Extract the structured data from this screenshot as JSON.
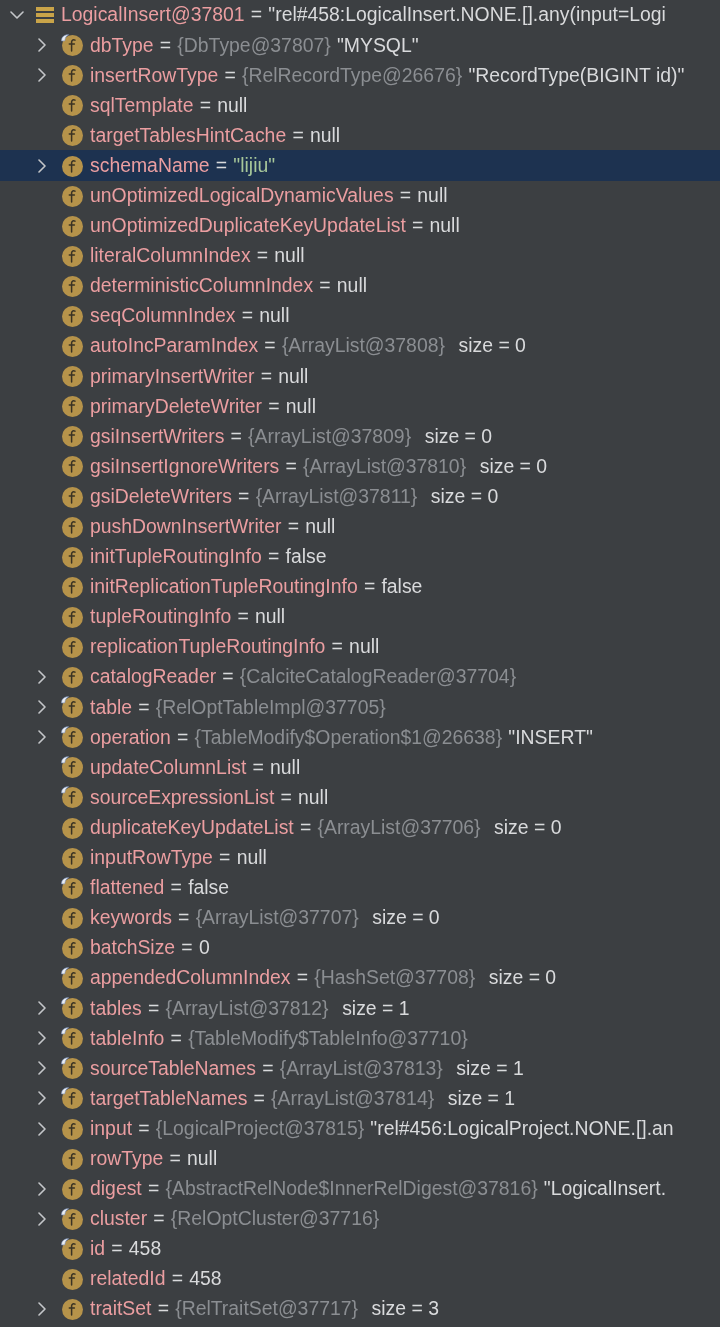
{
  "tree": {
    "root": {
      "name": "LogicalInsert@37801",
      "sign": "=",
      "value": "\"rel#458:LogicalInsert.NONE.[].any(input=Logi",
      "expanded": true,
      "selected": false
    },
    "fields": [
      {
        "name": "dbType",
        "sign": "=",
        "type_ref": "{DbType@37807}",
        "value": "\"MYSQL\"",
        "kind": "plain",
        "expandable": true,
        "expanded": false,
        "marked": true,
        "selected": false
      },
      {
        "name": "insertRowType",
        "sign": "=",
        "type_ref": "{RelRecordType@26676}",
        "value": "\"RecordType(BIGINT id)\"",
        "kind": "plain",
        "expandable": true,
        "expanded": false,
        "marked": false,
        "selected": false
      },
      {
        "name": "sqlTemplate",
        "sign": "=",
        "value": "null",
        "kind": "plain",
        "expandable": false,
        "marked": false,
        "selected": false
      },
      {
        "name": "targetTablesHintCache",
        "sign": "=",
        "value": "null",
        "kind": "plain",
        "expandable": false,
        "marked": false,
        "selected": false
      },
      {
        "name": "schemaName",
        "sign": "=",
        "value": "\"lijiu\"",
        "kind": "string",
        "expandable": true,
        "expanded": false,
        "marked": false,
        "selected": true
      },
      {
        "name": "unOptimizedLogicalDynamicValues",
        "sign": "=",
        "value": "null",
        "kind": "plain",
        "expandable": false,
        "marked": false,
        "selected": false
      },
      {
        "name": "unOptimizedDuplicateKeyUpdateList",
        "sign": "=",
        "value": "null",
        "kind": "plain",
        "expandable": false,
        "marked": false,
        "selected": false
      },
      {
        "name": "literalColumnIndex",
        "sign": "=",
        "value": "null",
        "kind": "plain",
        "expandable": false,
        "marked": false,
        "selected": false
      },
      {
        "name": "deterministicColumnIndex",
        "sign": "=",
        "value": "null",
        "kind": "plain",
        "expandable": false,
        "marked": false,
        "selected": false
      },
      {
        "name": "seqColumnIndex",
        "sign": "=",
        "value": "null",
        "kind": "plain",
        "expandable": false,
        "marked": false,
        "selected": false
      },
      {
        "name": "autoIncParamIndex",
        "sign": "=",
        "type_ref": "{ArrayList@37808}",
        "value": "size = 0",
        "kind": "size",
        "expandable": false,
        "marked": false,
        "selected": false
      },
      {
        "name": "primaryInsertWriter",
        "sign": "=",
        "value": "null",
        "kind": "plain",
        "expandable": false,
        "marked": false,
        "selected": false
      },
      {
        "name": "primaryDeleteWriter",
        "sign": "=",
        "value": "null",
        "kind": "plain",
        "expandable": false,
        "marked": false,
        "selected": false
      },
      {
        "name": "gsiInsertWriters",
        "sign": "=",
        "type_ref": "{ArrayList@37809}",
        "value": "size = 0",
        "kind": "size",
        "expandable": false,
        "marked": false,
        "selected": false
      },
      {
        "name": "gsiInsertIgnoreWriters",
        "sign": "=",
        "type_ref": "{ArrayList@37810}",
        "value": "size = 0",
        "kind": "size",
        "expandable": false,
        "marked": false,
        "selected": false
      },
      {
        "name": "gsiDeleteWriters",
        "sign": "=",
        "type_ref": "{ArrayList@37811}",
        "value": "size = 0",
        "kind": "size",
        "expandable": false,
        "marked": false,
        "selected": false
      },
      {
        "name": "pushDownInsertWriter",
        "sign": "=",
        "value": "null",
        "kind": "plain",
        "expandable": false,
        "marked": false,
        "selected": false
      },
      {
        "name": "initTupleRoutingInfo",
        "sign": "=",
        "value": "false",
        "kind": "plain",
        "expandable": false,
        "marked": false,
        "selected": false
      },
      {
        "name": "initReplicationTupleRoutingInfo",
        "sign": "=",
        "value": "false",
        "kind": "plain",
        "expandable": false,
        "marked": false,
        "selected": false
      },
      {
        "name": "tupleRoutingInfo",
        "sign": "=",
        "value": "null",
        "kind": "plain",
        "expandable": false,
        "marked": false,
        "selected": false
      },
      {
        "name": "replicationTupleRoutingInfo",
        "sign": "=",
        "value": "null",
        "kind": "plain",
        "expandable": false,
        "marked": false,
        "selected": false
      },
      {
        "name": "catalogReader",
        "sign": "=",
        "type_ref": "{CalciteCatalogReader@37704}",
        "expandable": true,
        "expanded": false,
        "marked": false,
        "selected": false
      },
      {
        "name": "table",
        "sign": "=",
        "type_ref": "{RelOptTableImpl@37705}",
        "expandable": true,
        "expanded": false,
        "marked": true,
        "selected": false
      },
      {
        "name": "operation",
        "sign": "=",
        "type_ref": "{TableModify$Operation$1@26638}",
        "value": "\"INSERT\"",
        "kind": "plain",
        "expandable": true,
        "expanded": false,
        "marked": true,
        "selected": false
      },
      {
        "name": "updateColumnList",
        "sign": "=",
        "value": "null",
        "kind": "plain",
        "expandable": false,
        "marked": true,
        "selected": false
      },
      {
        "name": "sourceExpressionList",
        "sign": "=",
        "value": "null",
        "kind": "plain",
        "expandable": false,
        "marked": true,
        "selected": false
      },
      {
        "name": "duplicateKeyUpdateList",
        "sign": "=",
        "type_ref": "{ArrayList@37706}",
        "value": "size = 0",
        "kind": "size",
        "expandable": false,
        "marked": false,
        "selected": false
      },
      {
        "name": "inputRowType",
        "sign": "=",
        "value": "null",
        "kind": "plain",
        "expandable": false,
        "marked": false,
        "selected": false
      },
      {
        "name": "flattened",
        "sign": "=",
        "value": "false",
        "kind": "plain",
        "expandable": false,
        "marked": true,
        "selected": false
      },
      {
        "name": "keywords",
        "sign": "=",
        "type_ref": "{ArrayList@37707}",
        "value": "size = 0",
        "kind": "size",
        "expandable": false,
        "marked": false,
        "selected": false
      },
      {
        "name": "batchSize",
        "sign": "=",
        "value": "0",
        "kind": "plain",
        "expandable": false,
        "marked": false,
        "selected": false
      },
      {
        "name": "appendedColumnIndex",
        "sign": "=",
        "type_ref": "{HashSet@37708}",
        "value": "size = 0",
        "kind": "size",
        "expandable": false,
        "marked": true,
        "selected": false
      },
      {
        "name": "tables",
        "sign": "=",
        "type_ref": "{ArrayList@37812}",
        "value": "size = 1",
        "kind": "size",
        "expandable": true,
        "expanded": false,
        "marked": true,
        "selected": false
      },
      {
        "name": "tableInfo",
        "sign": "=",
        "type_ref": "{TableModify$TableInfo@37710}",
        "expandable": true,
        "expanded": false,
        "marked": true,
        "selected": false
      },
      {
        "name": "sourceTableNames",
        "sign": "=",
        "type_ref": "{ArrayList@37813}",
        "value": "size = 1",
        "kind": "size",
        "expandable": true,
        "expanded": false,
        "marked": true,
        "selected": false
      },
      {
        "name": "targetTableNames",
        "sign": "=",
        "type_ref": "{ArrayList@37814}",
        "value": "size = 1",
        "kind": "size",
        "expandable": true,
        "expanded": false,
        "marked": true,
        "selected": false
      },
      {
        "name": "input",
        "sign": "=",
        "type_ref": "{LogicalProject@37815}",
        "value": "\"rel#456:LogicalProject.NONE.[].an",
        "kind": "plain",
        "expandable": true,
        "expanded": false,
        "marked": false,
        "selected": false
      },
      {
        "name": "rowType",
        "sign": "=",
        "value": "null",
        "kind": "plain",
        "expandable": false,
        "marked": false,
        "selected": false
      },
      {
        "name": "digest",
        "sign": "=",
        "type_ref": "{AbstractRelNode$InnerRelDigest@37816}",
        "value": "\"LogicalInsert.",
        "kind": "plain",
        "expandable": true,
        "expanded": false,
        "marked": false,
        "selected": false
      },
      {
        "name": "cluster",
        "sign": "=",
        "type_ref": "{RelOptCluster@37716}",
        "expandable": true,
        "expanded": false,
        "marked": true,
        "selected": false
      },
      {
        "name": "id",
        "sign": "=",
        "value": "458",
        "kind": "plain",
        "expandable": false,
        "marked": true,
        "selected": false
      },
      {
        "name": "relatedId",
        "sign": "=",
        "value": "458",
        "kind": "plain",
        "expandable": false,
        "marked": false,
        "selected": false
      },
      {
        "name": "traitSet",
        "sign": "=",
        "type_ref": "{RelTraitSet@37717}",
        "value": "size = 3",
        "kind": "size",
        "expandable": true,
        "expanded": false,
        "marked": false,
        "selected": false
      }
    ]
  }
}
